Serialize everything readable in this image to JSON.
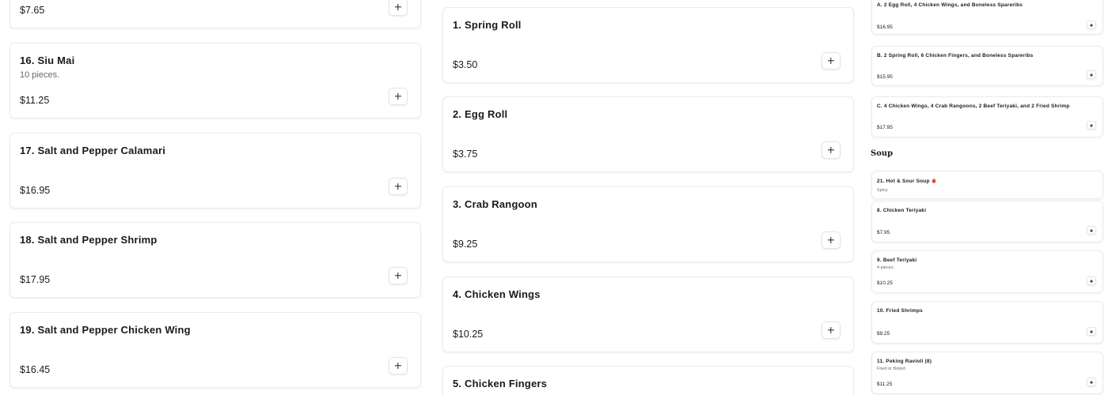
{
  "col1": {
    "items": [
      {
        "price": "$7.65",
        "add_label": "+"
      },
      {
        "name": "16. Siu Mai",
        "description": "10 pieces.",
        "price": "$11.25",
        "add_label": "+"
      },
      {
        "name": "17. Salt and Pepper Calamari",
        "price": "$16.95",
        "add_label": "+"
      },
      {
        "name": "18. Salt and Pepper Shrimp",
        "price": "$17.95",
        "add_label": "+"
      },
      {
        "name": "19. Salt and Pepper Chicken Wing",
        "price": "$16.45",
        "add_label": "+"
      }
    ]
  },
  "col2": {
    "items": [
      {
        "name": "1. Spring Roll",
        "price": "$3.50",
        "add_label": "+"
      },
      {
        "name": "2. Egg Roll",
        "price": "$3.75",
        "add_label": "+"
      },
      {
        "name": "3. Crab Rangoon",
        "price": "$9.25",
        "add_label": "+"
      },
      {
        "name": "4. Chicken Wings",
        "price": "$10.25",
        "add_label": "+"
      },
      {
        "name": "5. Chicken Fingers"
      }
    ]
  },
  "col3": {
    "combos": [
      {
        "name": "A. 2 Egg Roll, 4 Chicken Wings, and Boneless Spareribs",
        "price": "$16.95",
        "add_label": "+"
      },
      {
        "name": "B. 2 Spring Roll, 6 Chicken Fingers, and Boneless Spareribs",
        "price": "$15.95",
        "add_label": "+"
      },
      {
        "name": "C. 4 Chicken Wings, 4 Crab Rangoons, 2 Beef Teriyaki, and 2 Fried Shrimp",
        "price": "$17.95",
        "add_label": "+"
      }
    ],
    "section_heading": "Soup",
    "soup": {
      "name": "21. Hot & Sour Soup",
      "spicy_icon": "chili-pepper-icon",
      "description": "Spicy."
    },
    "items": [
      {
        "name": "8. Chicken Teriyaki",
        "price": "$7.95",
        "add_label": "+"
      },
      {
        "name": "9. Beef Teriyaki",
        "description": "4 pieces.",
        "price": "$10.25",
        "add_label": "+"
      },
      {
        "name": "10. Fried Shrimps",
        "price": "$9.25",
        "add_label": "+"
      },
      {
        "name": "11. Peking Ravioli (8)",
        "description": "Fried or Boiled",
        "price": "$11.25",
        "add_label": "+"
      }
    ]
  },
  "colors": {
    "text": "#1a1a1a",
    "muted": "#6b6b6b",
    "border": "#ebebeb",
    "spicy": "#e8452c"
  }
}
